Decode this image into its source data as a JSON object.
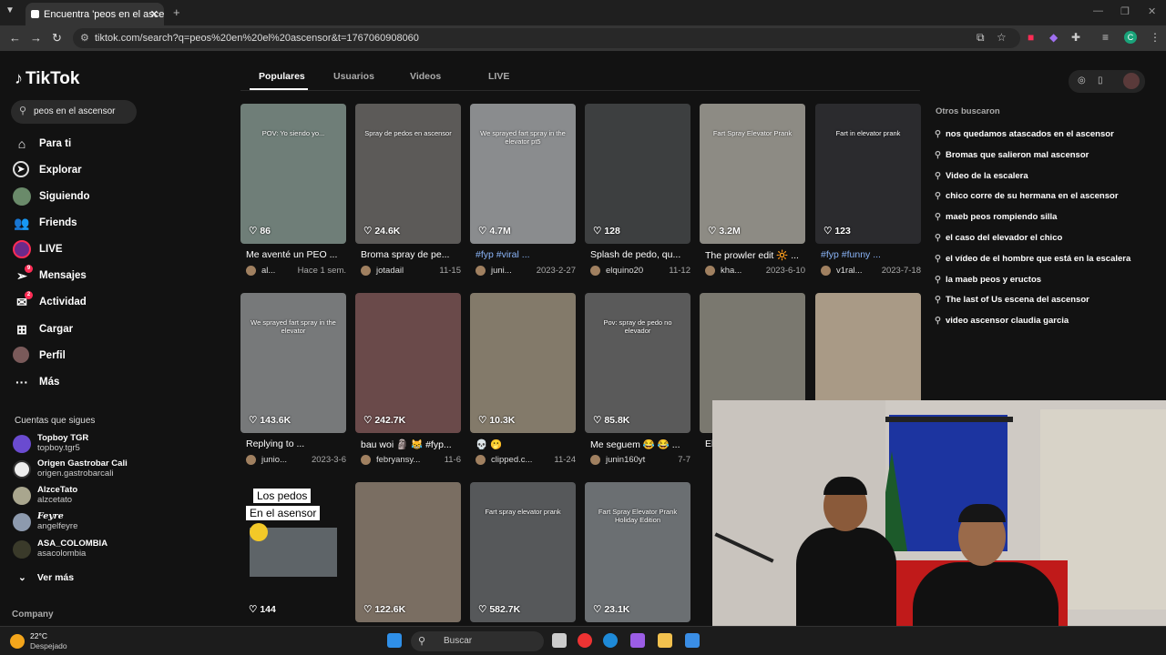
{
  "browser": {
    "tab_title": "Encuentra 'peos en el ascensor'",
    "url": "tiktok.com/search?q=peos%20en%20el%20ascensor&t=1767060908060"
  },
  "brand": {
    "name": "TikTok"
  },
  "search": {
    "query": "peos en el ascensor"
  },
  "nav": [
    {
      "label": "Para ti",
      "icon": "home-icon"
    },
    {
      "label": "Explorar",
      "icon": "compass-icon"
    },
    {
      "label": "Siguiendo",
      "icon": "following-icon"
    },
    {
      "label": "Friends",
      "icon": "friends-icon"
    },
    {
      "label": "LIVE",
      "icon": "live-icon"
    },
    {
      "label": "Mensajes",
      "icon": "messages-icon",
      "badge": "9"
    },
    {
      "label": "Actividad",
      "icon": "activity-icon",
      "badge": "2"
    },
    {
      "label": "Cargar",
      "icon": "upload-icon"
    },
    {
      "label": "Perfil",
      "icon": "profile-icon"
    },
    {
      "label": "Más",
      "icon": "more-icon"
    }
  ],
  "following": {
    "title": "Cuentas que sigues",
    "accounts": [
      {
        "name": "Topboy TGR",
        "handle": "topboy.tgr5"
      },
      {
        "name": "Origen Gastrobar Cali",
        "handle": "origen.gastrobarcali"
      },
      {
        "name": "AlzceTato",
        "handle": "alzcetato"
      },
      {
        "name": "Feyre",
        "handle": "angelfeyre"
      },
      {
        "name": "ASA_COLOMBIA",
        "handle": "asacolombia"
      }
    ],
    "more_label": "Ver más"
  },
  "company_label": "Company",
  "tabs": [
    "Populares",
    "Usuarios",
    "Videos",
    "LIVE"
  ],
  "videos": [
    {
      "likes": "86",
      "caption": "Me aventé un PEO ...",
      "user": "al...",
      "date": "Hace 1 sem.",
      "overlay": "POV: Yo siendo yo...",
      "color": "#6f7e78"
    },
    {
      "likes": "24.6K",
      "caption": "Broma spray de pe...",
      "user": "jotadail",
      "date": "11-15",
      "overlay": "Spray de pedos en ascensor",
      "color": "#5c5a58"
    },
    {
      "likes": "4.7M",
      "caption": "#fyp #viral ...",
      "user": "juni...",
      "date": "2023-2-27",
      "overlay": "We sprayed fart spray in the elevator pt5",
      "color": "#8a8c8e",
      "tag": true
    },
    {
      "likes": "128",
      "caption": "Splash de pedo, qu...",
      "user": "elquino20",
      "date": "11-12",
      "overlay": "",
      "color": "#3d3f40"
    },
    {
      "likes": "3.2M",
      "caption": "The prowler edit 🔆 ...",
      "user": "kha...",
      "date": "2023-6-10",
      "overlay": "Fart Spray Elevator Prank",
      "color": "#8d8b84"
    },
    {
      "likes": "123",
      "caption": "#fyp #funny ...",
      "user": "v1ral...",
      "date": "2023-7-18",
      "overlay": "Fart in elevator prank",
      "color": "#2b2b2e",
      "tag": true
    },
    {
      "likes": "143.6K",
      "caption": "Replying to ...",
      "user": "junio...",
      "date": "2023-3-6",
      "overlay": "We sprayed fart spray in the elevator",
      "color": "#77797a"
    },
    {
      "likes": "242.7K",
      "caption": "bau woi 🗿 😹 #fyp...",
      "user": "febryansy...",
      "date": "11-6",
      "overlay": "",
      "color": "#6a4a4a"
    },
    {
      "likes": "10.3K",
      "caption": "💀 🫢",
      "user": "clipped.c...",
      "date": "11-24",
      "overlay": "",
      "color": "#837a6a"
    },
    {
      "likes": "85.8K",
      "caption": "Me seguem 😂 😂 ...",
      "user": "junin160yt",
      "date": "7-7",
      "overlay": "Pov: spray de pedo no elevador",
      "color": "#5a5a5a"
    },
    {
      "likes": "",
      "caption": "El...",
      "user": "",
      "date": "",
      "overlay": "",
      "color": "#7a786f"
    },
    {
      "likes": "",
      "caption": "",
      "user": "",
      "date": "",
      "overlay": "",
      "color": "#a99a86"
    },
    {
      "likes": "144",
      "caption": "",
      "user": "",
      "date": "",
      "overlay": "",
      "color": "#121212"
    },
    {
      "likes": "122.6K",
      "caption": "",
      "user": "",
      "date": "",
      "overlay": "",
      "color": "#7a6e62"
    },
    {
      "likes": "582.7K",
      "caption": "",
      "user": "",
      "date": "",
      "overlay": "Fart spray elevator prank",
      "color": "#56585a"
    },
    {
      "likes": "23.1K",
      "caption": "",
      "user": "",
      "date": "",
      "overlay": "Fart Spray Elevator Prank Holiday Edition",
      "color": "#6b6f72"
    }
  ],
  "tile_text": {
    "line1": "Los pedos",
    "line2": "En el asensor"
  },
  "related": {
    "title": "Otros buscaron",
    "items": [
      "nos quedamos atascados en el ascensor",
      "Bromas que salieron mal ascensor",
      "Video de la escalera",
      "chico corre de su hermana en el ascensor",
      "maeb peos rompiendo silla",
      "el caso del elevador el chico",
      "el vídeo de el hombre que está en la escalera",
      "la maeb peos y eructos",
      "The last of Us escena del ascensor",
      "video ascensor claudia garcia"
    ]
  },
  "taskbar": {
    "temp": "22°C",
    "weather": "Despejado",
    "search_placeholder": "Buscar"
  }
}
